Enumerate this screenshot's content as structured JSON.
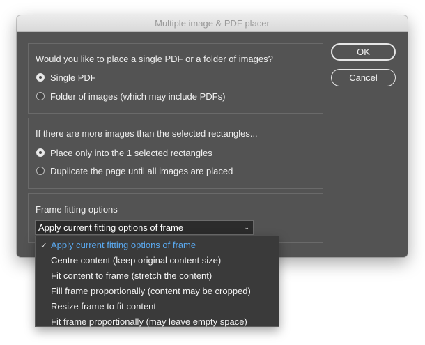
{
  "window": {
    "title": "Multiple image & PDF placer"
  },
  "buttons": {
    "ok": "OK",
    "cancel": "Cancel"
  },
  "source_panel": {
    "question": "Would you like to place a single PDF or a folder of images?",
    "options": [
      {
        "label": "Single PDF",
        "checked": true
      },
      {
        "label": "Folder of images (which may include PDFs)",
        "checked": false
      }
    ]
  },
  "overflow_panel": {
    "question": "If there are more images than the selected rectangles...",
    "options": [
      {
        "label": "Place only into the 1 selected rectangles",
        "checked": true
      },
      {
        "label": "Duplicate the page until all images are placed",
        "checked": false
      }
    ]
  },
  "fitting_panel": {
    "heading": "Frame fitting options",
    "selected_value": "Apply current fitting options of frame",
    "options": [
      {
        "label": "Apply current fitting options of frame",
        "selected": true
      },
      {
        "label": "Centre content (keep original content size)",
        "selected": false
      },
      {
        "label": "Fit content to frame (stretch the content)",
        "selected": false
      },
      {
        "label": "Fill frame proportionally (content may be cropped)",
        "selected": false
      },
      {
        "label": "Resize frame to fit content",
        "selected": false
      },
      {
        "label": "Fit frame proportionally (may leave empty space)",
        "selected": false
      }
    ]
  },
  "icons": {
    "select_chevron": "chevron-down-icon",
    "selected_check": "checkmark-icon"
  },
  "colors": {
    "dialog_bg": "#535353",
    "dropdown_bg": "#3a3a3a",
    "selected_item": "#5aa8ee"
  }
}
